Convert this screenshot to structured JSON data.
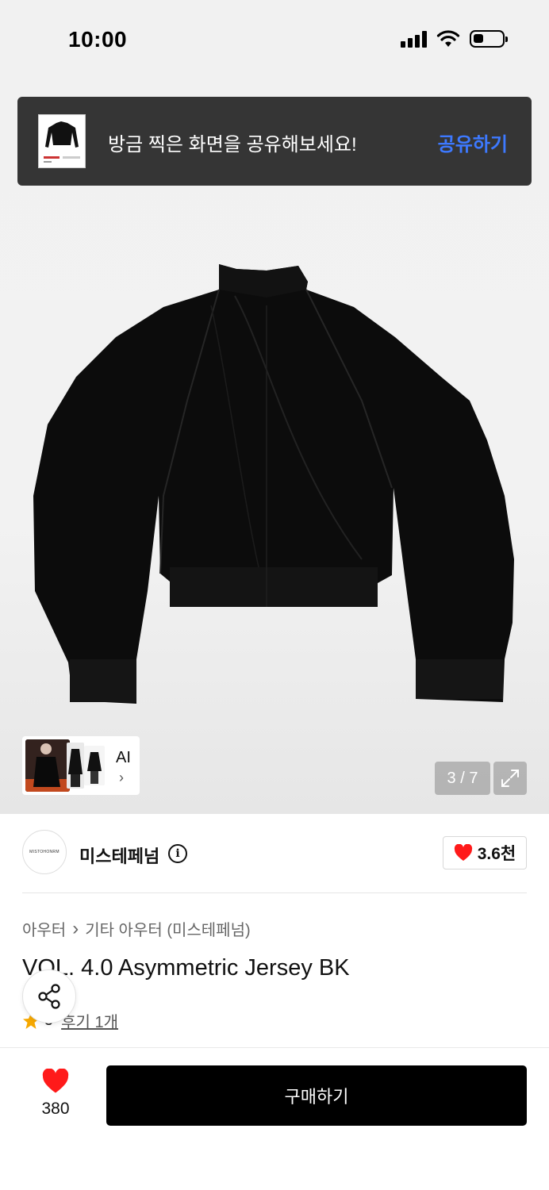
{
  "status_bar": {
    "time": "10:00",
    "battery_level": 0.3
  },
  "share_toast": {
    "message": "방금 찍은 화면을 공유해보세요!",
    "action_label": "공유하기",
    "action_color": "#3d79ff"
  },
  "gallery": {
    "counter": "3 / 7",
    "ai_label": "AI",
    "ai_chevron": "›"
  },
  "brand": {
    "logo_text": "MISTOHONRM",
    "name": "미스테페넘",
    "info_icon": "i",
    "likes": "3.6천"
  },
  "breadcrumb": {
    "category": "아우터",
    "separator": "›",
    "subcategory": "기타 아우터 (미스테페넘)"
  },
  "product": {
    "title": "VOL. 4.0 Asymmetric Jersey BK",
    "rating": "5",
    "review_link": "후기 1개"
  },
  "bottom_bar": {
    "wish_count": "380",
    "buy_label": "구매하기"
  },
  "colors": {
    "heart": "#ff1a1a",
    "star": "#f6a800",
    "buy_button": "#000000"
  },
  "icons": [
    "wifi-icon",
    "signal-icon",
    "battery-icon",
    "expand-icon",
    "share-icon",
    "heart-icon",
    "star-icon",
    "info-icon",
    "chevron-right-icon"
  ]
}
